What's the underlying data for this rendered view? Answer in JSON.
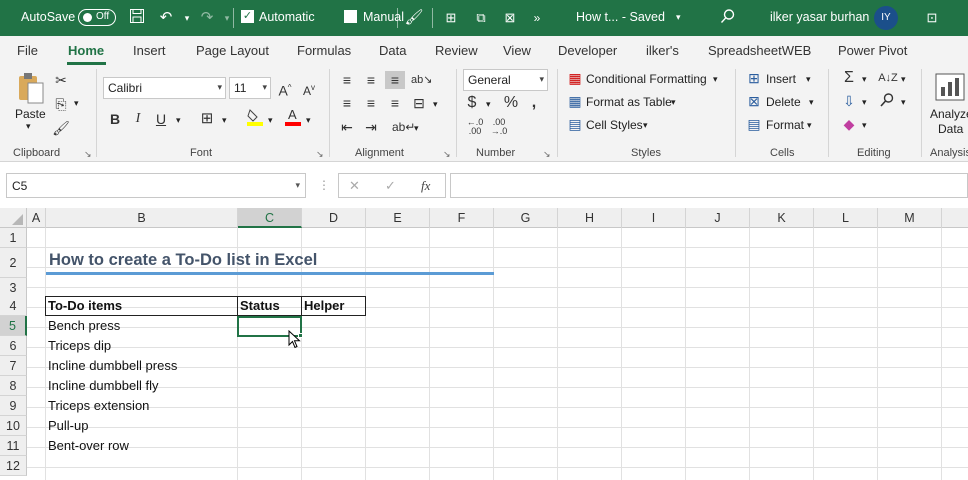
{
  "titlebar": {
    "autosave_label": "AutoSave",
    "autosave_state": "Off",
    "automatic_label": "Automatic",
    "manual_label": "Manual",
    "doc_title": "How t... - Saved",
    "user_name": "ilker yasar burhan",
    "user_initials": "IY",
    "accent_color": "#217346"
  },
  "tabs": [
    "File",
    "Home",
    "Insert",
    "Page Layout",
    "Formulas",
    "Data",
    "Review",
    "View",
    "Developer",
    "ilker's",
    "SpreadsheetWEB",
    "Power Pivot"
  ],
  "active_tab": "Home",
  "ribbon": {
    "clipboard": {
      "paste_label": "Paste",
      "group_label": "Clipboard"
    },
    "font": {
      "font_name": "Calibri",
      "font_size": "11",
      "group_label": "Font",
      "bold": "B",
      "italic": "I",
      "underline": "U",
      "highlight_color": "#ffff00",
      "font_color": "#ff0000"
    },
    "alignment": {
      "group_label": "Alignment"
    },
    "number": {
      "format": "General",
      "group_label": "Number",
      "currency": "$",
      "percent": "%"
    },
    "styles": {
      "conditional_formatting": "Conditional Formatting",
      "format_as_table": "Format as Table",
      "cell_styles": "Cell Styles",
      "group_label": "Styles"
    },
    "cells": {
      "insert": "Insert",
      "delete": "Delete",
      "format": "Format",
      "group_label": "Cells"
    },
    "editing": {
      "group_label": "Editing"
    },
    "analysis": {
      "analyze_label_1": "Analyze",
      "analyze_label_2": "Data",
      "group_label": "Analysis"
    }
  },
  "formula_bar": {
    "name_box": "C5",
    "fx": "fx",
    "cancel": "✕",
    "enter": "✓",
    "content": ""
  },
  "columns": [
    "A",
    "B",
    "C",
    "D",
    "E",
    "F",
    "G",
    "H",
    "I",
    "J",
    "K",
    "L",
    "M"
  ],
  "rows": [
    "1",
    "2",
    "3",
    "4",
    "5",
    "6",
    "7",
    "8",
    "9",
    "10",
    "11",
    "12"
  ],
  "sheet": {
    "title": "How to create a To-Do list in Excel",
    "header_todo": "To-Do items",
    "header_status": "Status",
    "header_helper": "Helper",
    "items": [
      "Bench press",
      "Triceps dip",
      "Incline dumbbell press",
      "Incline dumbbell fly",
      "Triceps extension",
      "Pull-up",
      "Bent-over row"
    ],
    "title_color": "#44546a",
    "title_underline_color": "#5b9bd5"
  }
}
